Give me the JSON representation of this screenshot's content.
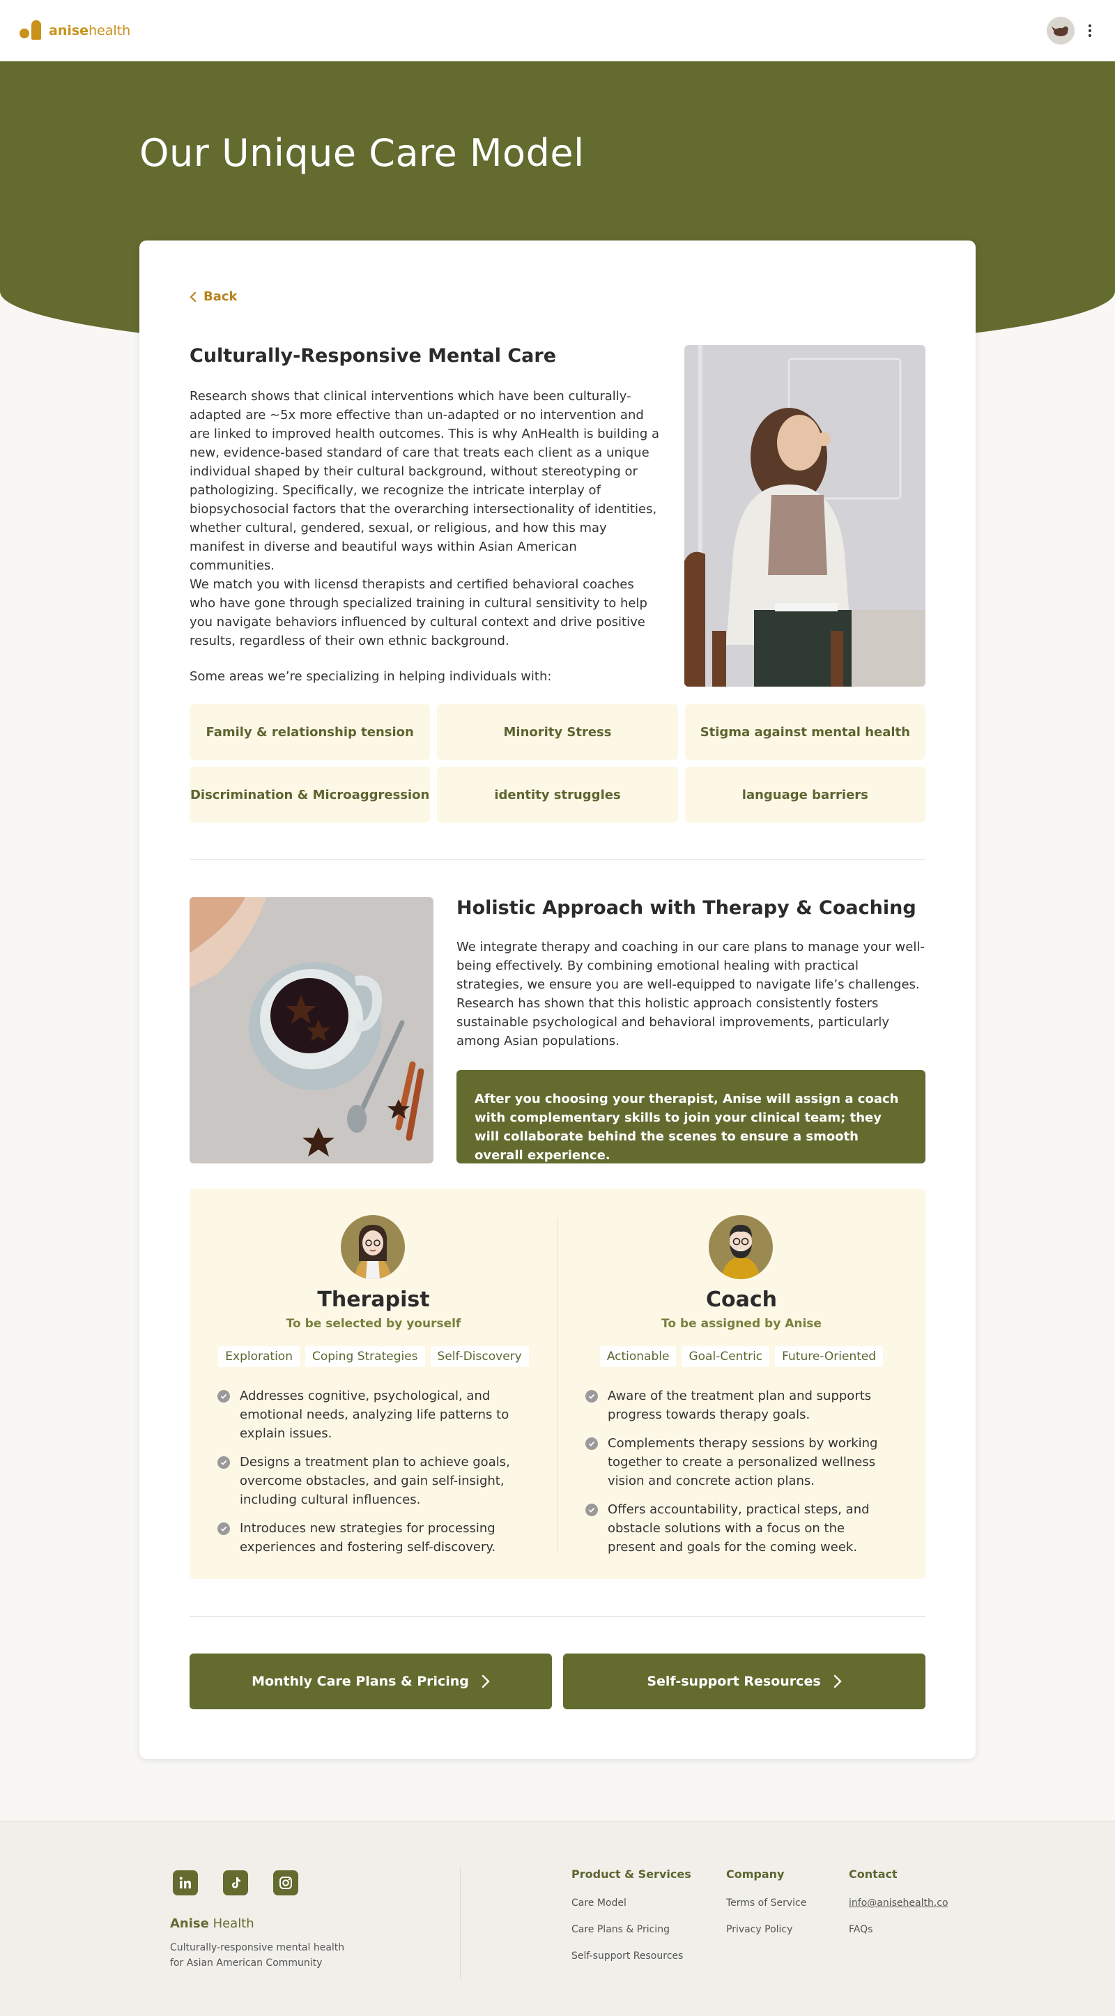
{
  "app": {
    "logo_bold": "anise",
    "logo_light": "health"
  },
  "hero": {
    "title": "Our Unique Care Model"
  },
  "back_label": "Back",
  "section1": {
    "title": "Culturally-Responsive Mental Care",
    "p1": "Research shows that clinical interventions which have been culturally-adapted are ~5x more effective than un-adapted or no intervention and are linked to improved health outcomes. This is why AnHealth is building a new, evidence-based standard of care that treats each client as a unique individual shaped by their cultural background, without stereotyping or pathologizing. Specifically, we recognize the intricate interplay of biopsychosocial factors that the overarching intersectionality of identities, whether cultural, gendered, sexual, or religious, and how this may manifest in diverse and beautiful ways within Asian American communities.",
    "p2": "We match you with licensd therapists and certified behavioral coaches who have gone through specialized training in cultural sensitivity to help you navigate behaviors influenced by cultural context and drive positive results, regardless of their own ethnic background.",
    "p3": "Some areas we’re specializing in helping individuals with:",
    "tags": [
      "Family & relationship tension",
      "Minority Stress",
      "Stigma against mental health",
      "Discrimination & Microaggression",
      "identity struggles",
      "language barriers"
    ]
  },
  "section2": {
    "title": "Holistic Approach with Therapy & Coaching",
    "p1": "We integrate therapy and coaching in our care plans to manage your well-being effectively. By combining emotional healing with practical strategies, we ensure you are well-equipped to navigate life’s challenges. Research has shown that this holistic approach consistently fosters sustainable psychological and behavioral improvements, particularly among Asian populations.",
    "callout": "After you choosing your therapist, Anise will assign a coach with complementary skills to join your clinical team; they will collaborate behind the scenes to ensure a smooth overall experience."
  },
  "therapist": {
    "title": "Therapist",
    "subtitle": "To be selected by yourself",
    "tags": [
      "Exploration",
      "Coping Strategies",
      "Self-Discovery"
    ],
    "points": [
      "Addresses cognitive, psychological, and emotional needs, analyzing life patterns to explain issues.",
      "Designs a treatment plan to achieve goals, overcome obstacles, and gain self-insight, including cultural influences.",
      "Introduces new strategies for processing experiences and fostering self-discovery."
    ]
  },
  "coach": {
    "title": "Coach",
    "subtitle": "To be assigned by Anise",
    "tags": [
      "Actionable",
      "Goal-Centric",
      "Future-Oriented"
    ],
    "points": [
      "Aware of the treatment plan and supports progress towards therapy goals.",
      "Complements therapy sessions by working together to create a personalized wellness vision and concrete action plans.",
      "Offers accountability, practical steps, and obstacle solutions with a focus on the present and goals for the coming week."
    ]
  },
  "buttons": {
    "pricing": "Monthly Care Plans & Pricing",
    "resources": "Self-support Resources"
  },
  "footer": {
    "brand_bold": "Anise",
    "brand_light": " Health",
    "tagline": "Culturally-responsive mental health for Asian American Community",
    "social_icons": [
      "linkedin-icon",
      "tiktok-icon",
      "instagram-icon"
    ],
    "col1": {
      "title": "Product & Services",
      "links": [
        "Care Model",
        "Care Plans & Pricing",
        "Self-support Resources"
      ]
    },
    "col2": {
      "title": "Company",
      "links": [
        "Terms of Service",
        "Privacy Policy"
      ]
    },
    "col3": {
      "title": "Contact",
      "links": [
        "info@anisehealth.co",
        "FAQs"
      ]
    }
  },
  "colors": {
    "olive": "#636b2f",
    "gold": "#c8921a",
    "cream": "#fdf7e6"
  }
}
